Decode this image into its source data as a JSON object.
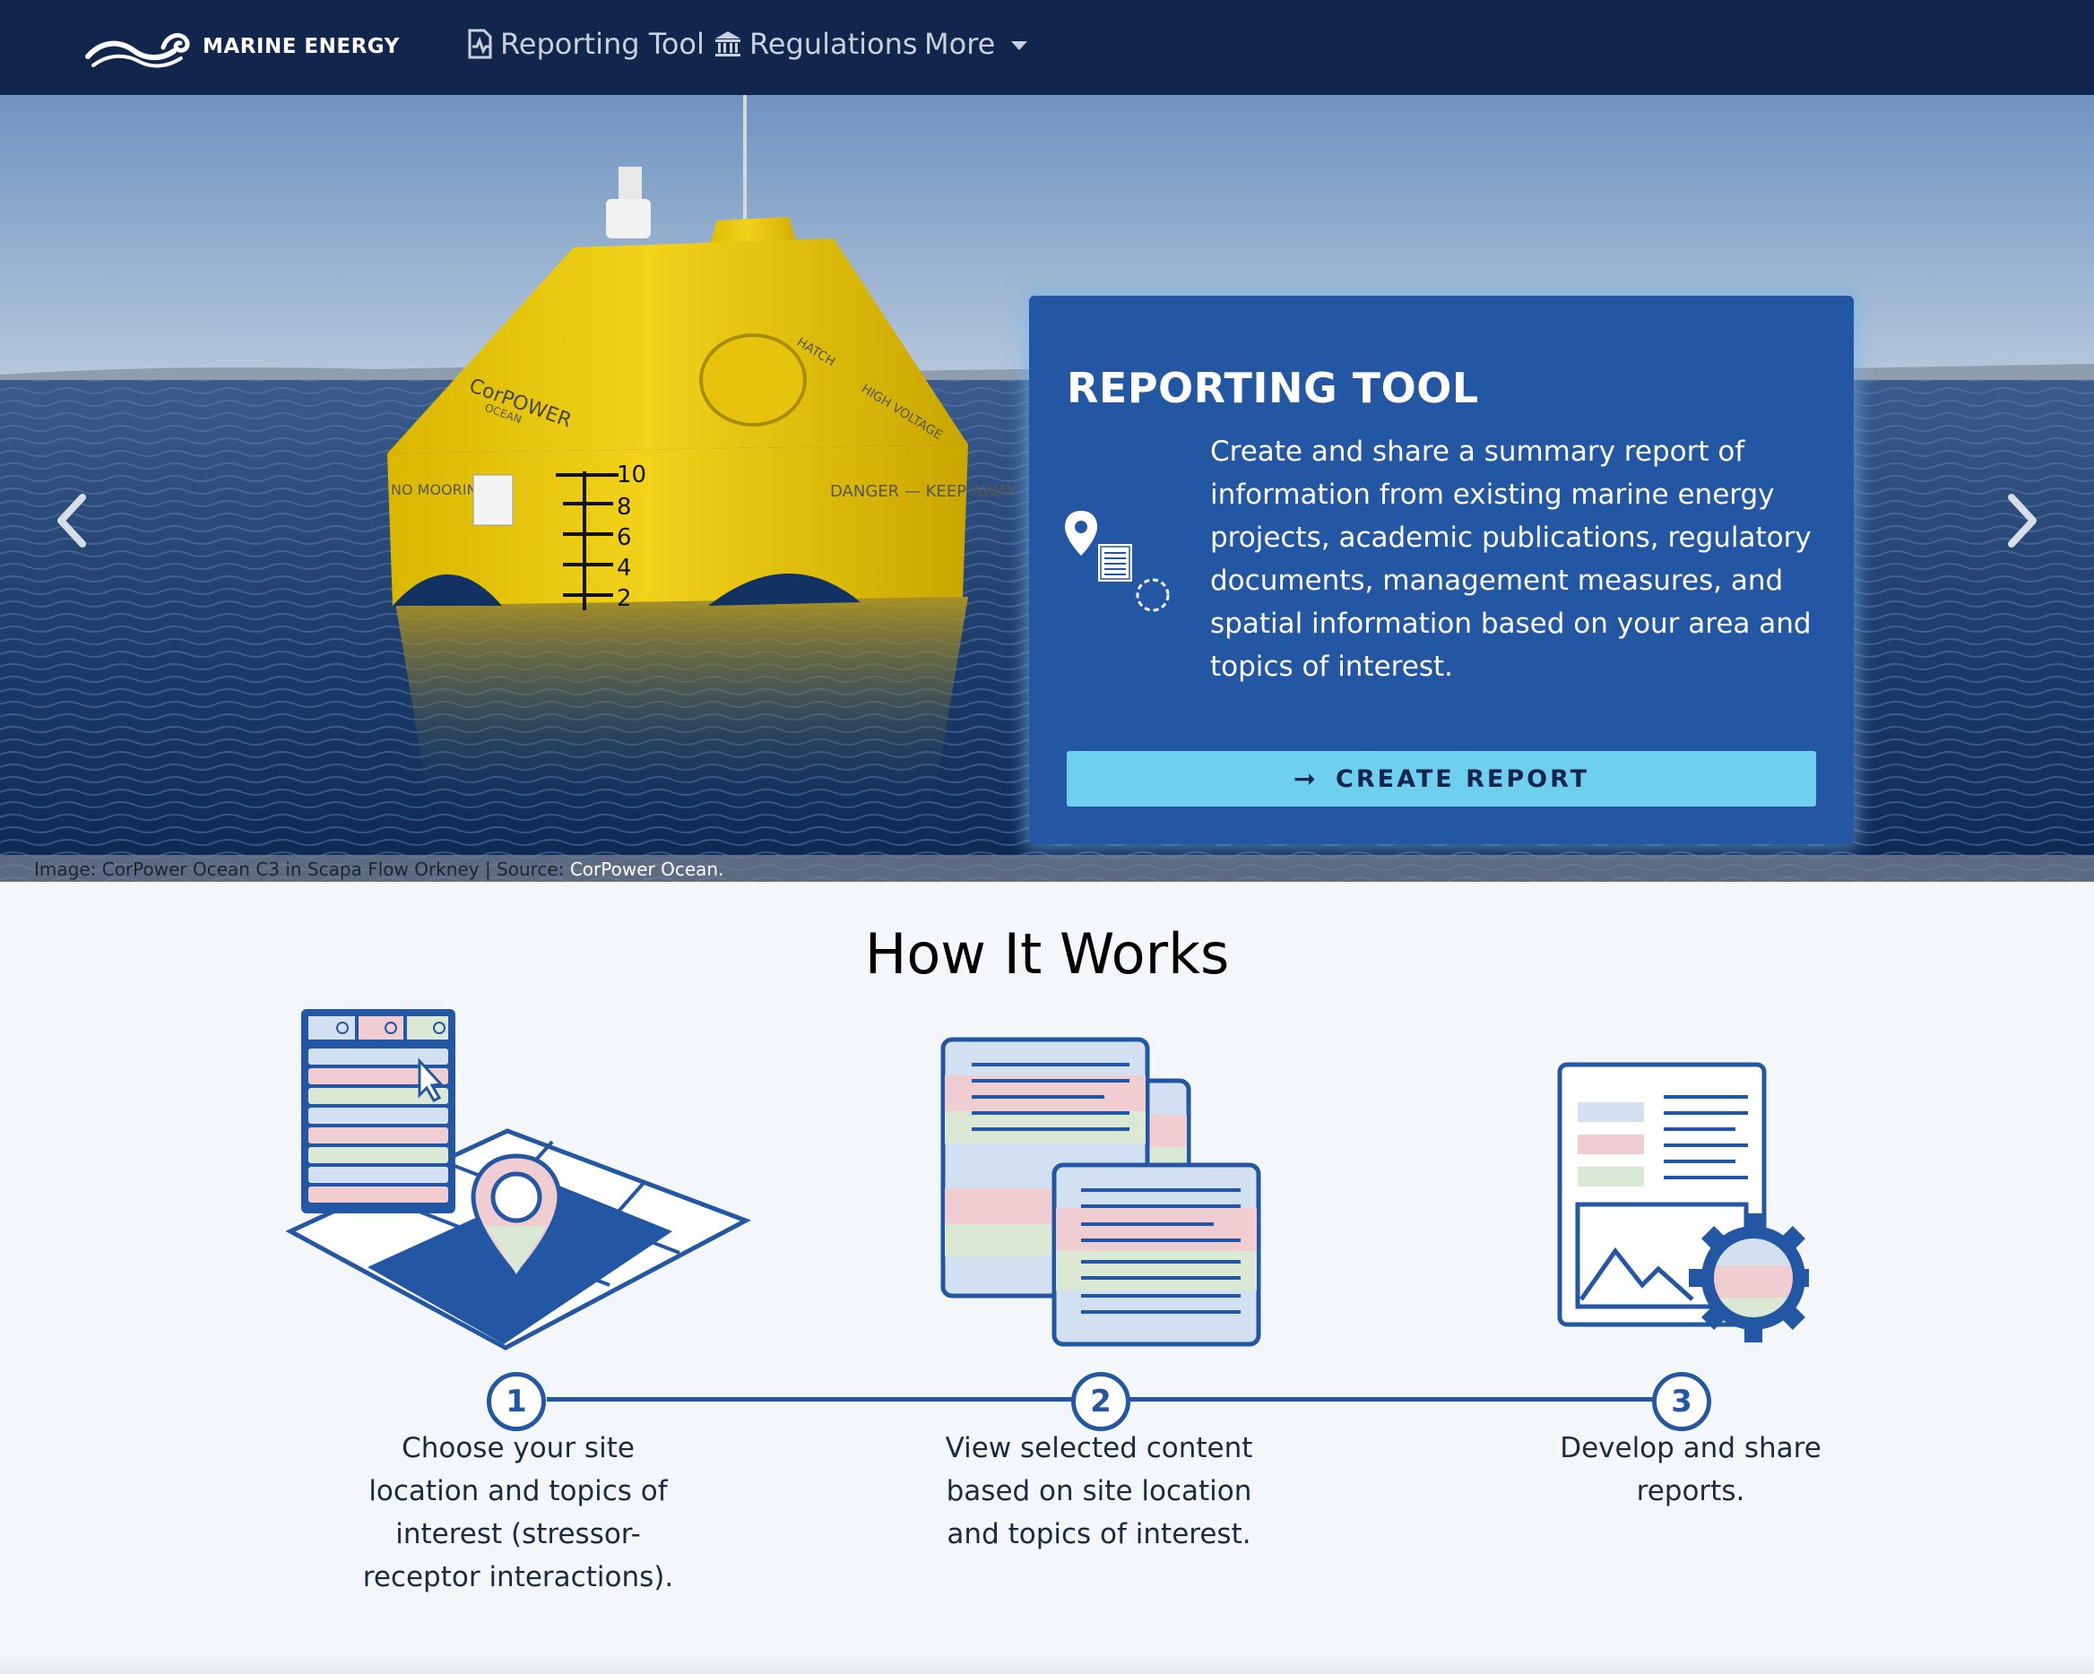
{
  "navbar": {
    "brand": "MARINE ENERGY",
    "items": [
      {
        "label": "Reporting Tool",
        "icon": "report-chart-icon"
      },
      {
        "label": "Regulations",
        "icon": "government-building-icon"
      },
      {
        "label": "More",
        "icon": "chevron-down-icon"
      }
    ]
  },
  "hero": {
    "caption_prefix": "Image: CorPower Ocean C3 in Scapa Flow Orkney | Source: ",
    "caption_link": "CorPower Ocean.",
    "buoy_brand": "CorPOWER",
    "buoy_sub": "OCEAN",
    "buoy_warning": "DANGER — KEEP AWAY",
    "buoy_mooring": "NO MOORING",
    "buoy_hatch": "HATCH",
    "buoy_hv": "HIGH VOLTAGE",
    "scale_marks": [
      "10",
      "8",
      "6",
      "4",
      "2"
    ]
  },
  "card": {
    "title": "REPORTING TOOL",
    "description": "Create and share a summary report of information from existing marine energy projects, academic publications, regulatory documents, management measures, and spatial information based on your area and topics of interest.",
    "button_label": "CREATE REPORT",
    "button_icon": "arrow-right-icon"
  },
  "how_it_works": {
    "title": "How It Works",
    "steps": [
      {
        "number": "1",
        "text": "Choose your site location and topics of interest (stressor-receptor interactions)."
      },
      {
        "number": "2",
        "text": "View selected content based on site location and topics of interest."
      },
      {
        "number": "3",
        "text": "Develop and share reports."
      }
    ]
  },
  "colors": {
    "navbar": "#12264d",
    "card": "#2457a3",
    "button": "#6ecfee",
    "accent_pink": "#f0cdd0",
    "accent_blue": "#d3e0f2",
    "accent_green": "#dbe9d4"
  }
}
